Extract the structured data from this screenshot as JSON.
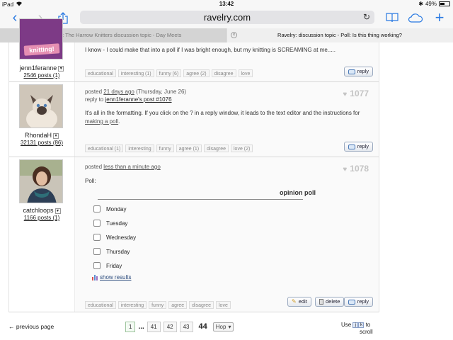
{
  "status": {
    "device": "iPad",
    "time": "13:42",
    "battery": "49%",
    "battery_level": 0.49
  },
  "browser": {
    "url": "ravelry.com",
    "tabs": [
      {
        "label": "Ravelry: The Harrow Knitters discussion topic - Day Meets",
        "active": false
      },
      {
        "label": "Ravelry: discussion topic - Poll: Is this thing working?",
        "active": true
      }
    ]
  },
  "posts": [
    {
      "username": "jenn1feranne",
      "post_count": "2546 posts (1)",
      "avatar_text": "knitting!",
      "body": "I know - I could make that into a poll if I was bright enough, but my knitting is SCREAMING at me.....",
      "reactions": [
        "educational",
        "interesting (1)",
        "funny (6)",
        "agree (2)",
        "disagree",
        "love"
      ],
      "reply_label": "reply"
    },
    {
      "username": "RhondaH",
      "post_count": "32131 posts (86)",
      "posted_prefix": "posted",
      "posted_when": "21 days ago",
      "posted_date": "(Thursday, June 26)",
      "reply_to_prefix": "reply to",
      "reply_to_link": "jenn1feranne's post #1076",
      "number": "1077",
      "body_prefix": "It's all in the formatting. If you click on the ? in a reply window, it leads to the text editor and the instructions for",
      "body_link": "making a poll",
      "body_suffix": ".",
      "reactions": [
        "educational (1)",
        "interesting",
        "funny",
        "agree (1)",
        "disagree",
        "love (2)"
      ],
      "reply_label": "reply"
    },
    {
      "username": "catchloops",
      "post_count": "1166 posts (1)",
      "posted_prefix": "posted",
      "posted_when": "less than a minute ago",
      "number": "1078",
      "body": "Poll:",
      "poll": {
        "title": "opinion poll",
        "options": [
          "Monday",
          "Tuesday",
          "Wednesday",
          "Thursday",
          "Friday"
        ],
        "show_results": "show results"
      },
      "reactions": [
        "educational",
        "interesting",
        "funny",
        "agree",
        "disagree",
        "love"
      ],
      "edit_label": "edit",
      "delete_label": "delete",
      "reply_label": "reply"
    }
  ],
  "footer": {
    "previous": "← previous page",
    "pages": [
      "1",
      "41",
      "42",
      "43"
    ],
    "ellipsis": "...",
    "current": "44",
    "hop": "Hop",
    "scroll_use": "Use",
    "scroll_to": "to",
    "scroll_word": "scroll"
  },
  "colors": {
    "accent": "#2a7ae2",
    "post_number": "#c4c4c4"
  }
}
